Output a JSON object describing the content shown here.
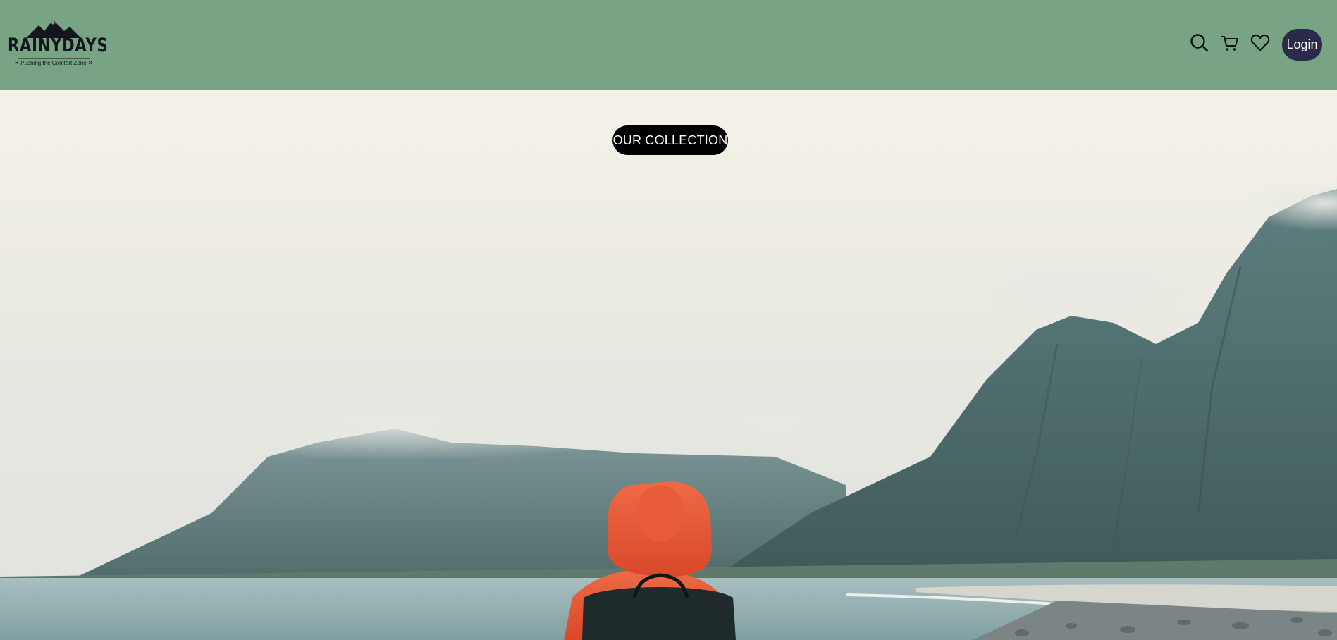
{
  "header": {
    "logo": {
      "wordmark": "RAINYDAYS",
      "tagline": "✕ Pushing the Comfort Zone ✕",
      "icon": "mountain-peaks"
    },
    "icons": {
      "search": "search-icon",
      "cart": "cart-icon",
      "wishlist": "heart-icon"
    },
    "login_label": "Login"
  },
  "hero": {
    "cta_label": "OUR COLLECTION",
    "image": "hiker-in-orange-hooded-jacket-facing-misty-mountains-by-the-sea"
  },
  "colors": {
    "header_bg": "#78a384",
    "login_bg": "#2a2a4a",
    "cta_bg": "#000000",
    "text_light": "#ffffff",
    "jacket": "#e4552f"
  }
}
